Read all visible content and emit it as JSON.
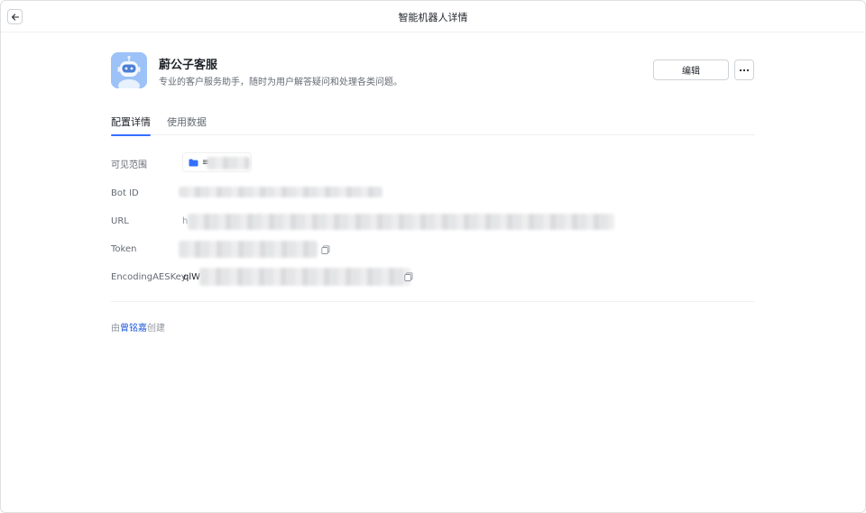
{
  "header": {
    "title": "智能机器人详情"
  },
  "bot": {
    "name": "蔚公子客服",
    "description": "专业的客户服务助手，随时为用户解答疑问和处理各类问题。"
  },
  "actions": {
    "edit_label": "编辑",
    "more_label": "···"
  },
  "tabs": [
    {
      "label": "配置详情",
      "active": true
    },
    {
      "label": "使用数据",
      "active": false
    }
  ],
  "fields": {
    "scope_label": "可见范围",
    "scope_value_visible": "≡",
    "bot_id_label": "Bot ID",
    "url_label": "URL",
    "url_value_visible": "h",
    "token_label": "Token",
    "aes_label": "EncodingAESKey",
    "aes_value_visible": "qlW"
  },
  "footer": {
    "prefix": "由",
    "creator": "曾铭嘉",
    "suffix": "创建"
  },
  "colors": {
    "accent": "#3370ff",
    "avatar_bg": "#9cc2f8"
  }
}
